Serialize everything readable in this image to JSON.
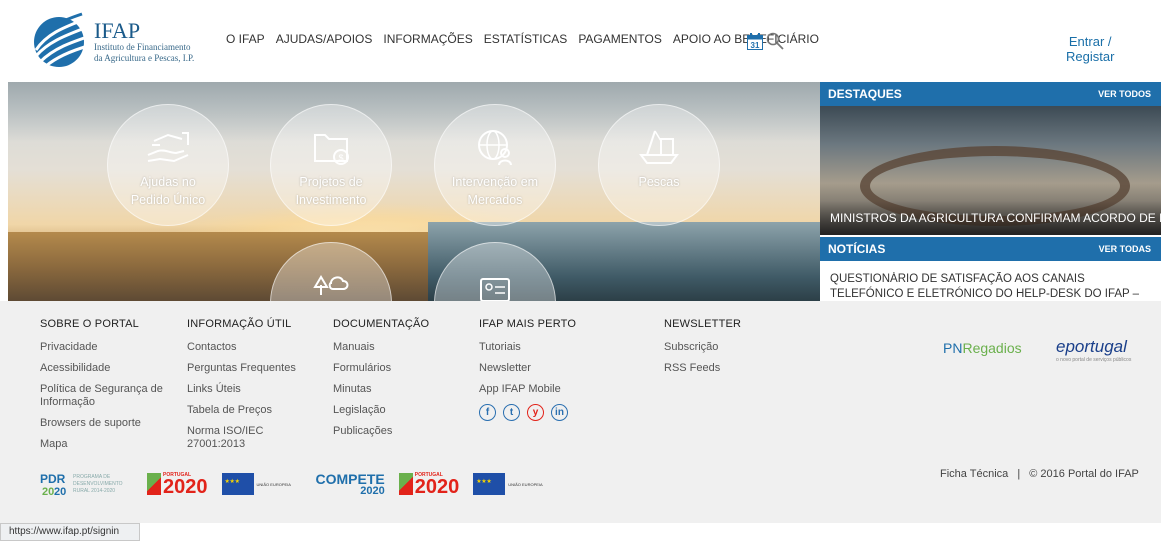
{
  "header": {
    "logo_title": "IFAP",
    "logo_sub1": "Instituto de Financiamento",
    "logo_sub2": "da Agricultura e Pescas, I.P.",
    "nav": [
      "O IFAP",
      "AJUDAS/APOIOS",
      "INFORMAÇÕES",
      "ESTATÍSTICAS",
      "PAGAMENTOS",
      "APOIO AO BENEFICIÁRIO"
    ],
    "calendar_day": "31",
    "login_line1": "Entrar /",
    "login_line2": "Registar"
  },
  "hero": {
    "tiles": [
      {
        "label1": "Ajudas no",
        "label2": "Pedido Único",
        "icon": "hand-coins-icon"
      },
      {
        "label1": "Projetos de",
        "label2": "Investimento",
        "icon": "folder-money-icon"
      },
      {
        "label1": "Intervenção em",
        "label2": "Mercados",
        "icon": "globe-person-icon"
      },
      {
        "label1": "Pescas",
        "label2": "",
        "icon": "fishing-boat-icon"
      },
      {
        "label1": "",
        "label2": "",
        "icon": "tree-cloud-icon"
      },
      {
        "label1": "",
        "label2": "",
        "icon": "id-card-icon"
      }
    ]
  },
  "sidebar": {
    "destaques_title": "DESTAQUES",
    "destaques_link": "VER TODOS",
    "destaque_caption": "MINISTROS DA AGRICULTURA CONFIRMAM ACORDO DE R...",
    "noticias_title": "NOTÍCIAS",
    "noticias_link": "VER TODAS",
    "news_text": "QUESTIONÁRIO DE SATISFAÇÃO AOS CANAIS TELEFÓNICO E ELETRÓNICO DO HELP-DESK DO IFAP – AGRADECIMENTO"
  },
  "footer": {
    "columns": [
      {
        "title": "SOBRE O PORTAL",
        "links": [
          "Privacidade",
          "Acessibilidade",
          "Política de Segurança de Informação",
          "Browsers de suporte",
          "Mapa"
        ]
      },
      {
        "title": "INFORMAÇÃO ÚTIL",
        "links": [
          "Contactos",
          "Perguntas Frequentes",
          "Links Úteis",
          "Tabela de Preços",
          "Norma ISO/IEC 27001:2013"
        ]
      },
      {
        "title": "DOCUMENTAÇÃO",
        "links": [
          "Manuais",
          "Formulários",
          "Minutas",
          "Legislação",
          "Publicações"
        ]
      },
      {
        "title": "IFAP MAIS PERTO",
        "links": [
          "Tutoriais",
          "Newsletter",
          "App IFAP Mobile"
        ]
      },
      {
        "title": "NEWSLETTER",
        "links": [
          "Subscrição",
          "RSS Feeds"
        ]
      }
    ],
    "social": [
      "f",
      "t",
      "y",
      "in"
    ],
    "pn_logo_a": "PN",
    "pn_logo_b": "Regadios",
    "eportugal": "eportugal",
    "eportugal_sub": "o novo portal de serviços públicos",
    "pdr_text": "PROGRAMA DE DESENVOLVIMENTO RURAL 2014-2020",
    "portugal_2020": "2020",
    "portugal_word": "PORTUGAL",
    "compete": "COMPETE",
    "compete_year": "2020",
    "uniao_europeia": "UNIÃO EUROPEIA",
    "ficha": "Ficha Técnica",
    "separator": "|",
    "copyright": "© 2016 Portal do IFAP"
  },
  "status_bar": "https://www.ifap.pt/signin",
  "colors": {
    "brand_blue": "#1f6fab",
    "green": "#6ab04c",
    "red": "#e2231a"
  }
}
